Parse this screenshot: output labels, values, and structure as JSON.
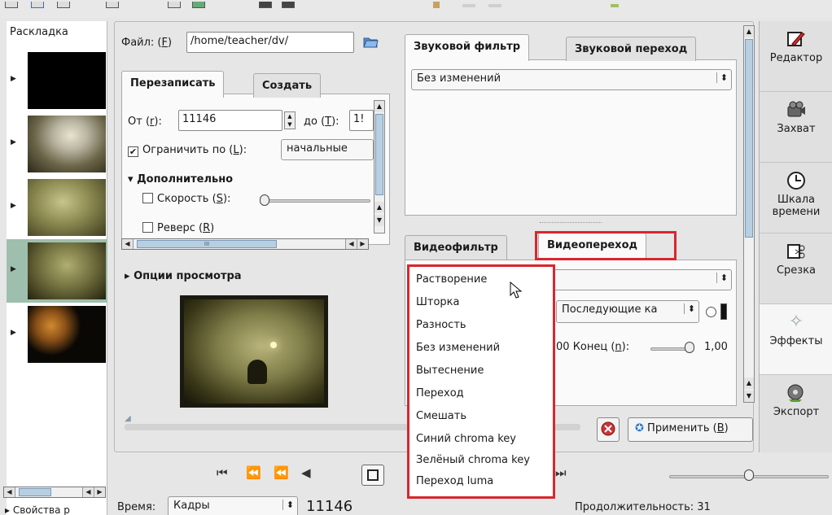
{
  "left_panel": {
    "title": "Раскладка",
    "clips": [
      {
        "thumb": "black-frame-thumbnail"
      },
      {
        "thumb": "white-horse-thumbnail"
      },
      {
        "thumb": "hedgehog-fog-thumbnail"
      },
      {
        "thumb": "hedgehog-lantern-thumbnail",
        "selected": true
      },
      {
        "thumb": "owl-night-thumbnail"
      }
    ],
    "properties_label": "Свойства р"
  },
  "file": {
    "label_prefix": "Файл: (",
    "label_key": "F",
    "label_suffix": ")",
    "value": "/home/teacher/dv/"
  },
  "mode_tabs": {
    "overwrite": "Перезаписать",
    "create": "Создать"
  },
  "range": {
    "from_prefix": "От (",
    "from_key": "r",
    "from_suffix": "):",
    "from_value": "11146",
    "to_prefix": "до (",
    "to_key": "T",
    "to_suffix": "):",
    "to_value": "1!"
  },
  "limit": {
    "label_prefix": "Ограничить по (",
    "label_key": "L",
    "label_suffix": "):",
    "checked": true,
    "option": "начальные"
  },
  "advanced": {
    "title": "Дополнительно",
    "speed_prefix": "Скорость (",
    "speed_key": "S",
    "speed_suffix": "):",
    "reverse_prefix": "Реверс (",
    "reverse_key": "R",
    "reverse_suffix": ")"
  },
  "preview": {
    "title": "Опции просмотра"
  },
  "audio_tabs": {
    "filter": "Звуковой фильтр",
    "transition": "Звуковой переход"
  },
  "audio_filter_value": "Без изменений",
  "video_tabs": {
    "filter": "Видеофильтр",
    "transition": "Видеопереход"
  },
  "video_transition": {
    "selected": "",
    "wipe_option": "Последующие ка",
    "end_prefix_value": "00",
    "end_prefix": "Конец (",
    "end_key": "n",
    "end_suffix": "):",
    "end_value": "1,00"
  },
  "transition_menu": [
    "Растворение",
    "Шторка",
    "Разность",
    "Без изменений",
    "Вытеснение",
    "Переход",
    "Смешать",
    "Синий chroma key",
    "Зелёный chroma key",
    "Переход luma"
  ],
  "apply_button": {
    "prefix": "Применить (",
    "key": "B",
    "suffix": ")"
  },
  "sidebar": [
    {
      "label": "Редактор",
      "icon": "editor-icon"
    },
    {
      "label": "Захват",
      "icon": "capture-icon"
    },
    {
      "label": "Шкала времени",
      "icon": "timeline-icon"
    },
    {
      "label": "Срезка",
      "icon": "trim-icon"
    },
    {
      "label": "Эффекты",
      "icon": "effects-icon",
      "active": true
    },
    {
      "label": "Экспорт",
      "icon": "export-icon"
    }
  ],
  "status": {
    "time_label": "Время:",
    "time_format": "Кадры",
    "frame_value": "11146",
    "duration_label": "Продолжительность: 31"
  },
  "scroll_mark": "III"
}
